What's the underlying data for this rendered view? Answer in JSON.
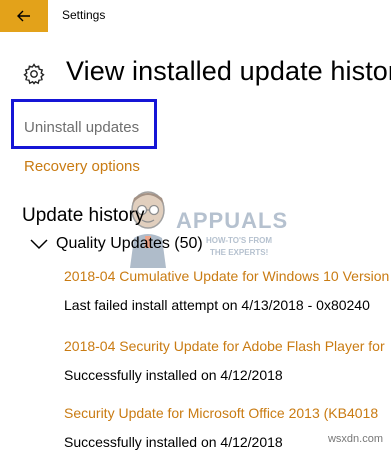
{
  "window": {
    "title": "Settings",
    "accent": "#e3a21a",
    "back_icon": "arrow-left-icon"
  },
  "header": {
    "title": "View installed update history",
    "icon": "gear-icon"
  },
  "links": {
    "uninstall": "Uninstall updates",
    "recovery": "Recovery options"
  },
  "update_history": {
    "title": "Update history",
    "group": {
      "label": "Quality Updates (50)",
      "expanded": true
    },
    "items": [
      {
        "name": "2018-04 Cumulative Update for Windows 10 Version",
        "status": "Last failed install attempt on 4/13/2018 - 0x80240"
      },
      {
        "name": "2018-04 Security Update for Adobe Flash Player for",
        "status": "Successfully installed on 4/12/2018"
      },
      {
        "name": "Security Update for Microsoft Office 2013 (KB4018",
        "status": "Successfully installed on 4/12/2018"
      }
    ]
  },
  "watermark": {
    "brand": "APPUALS",
    "tagline_1": "HOW-TO'S FROM",
    "tagline_2": "THE EXPERTS!"
  },
  "site": "wsxdn.com",
  "colors": {
    "link": "#c97b12",
    "highlight_box": "#1515d6",
    "muted": "#6f6f6f"
  }
}
